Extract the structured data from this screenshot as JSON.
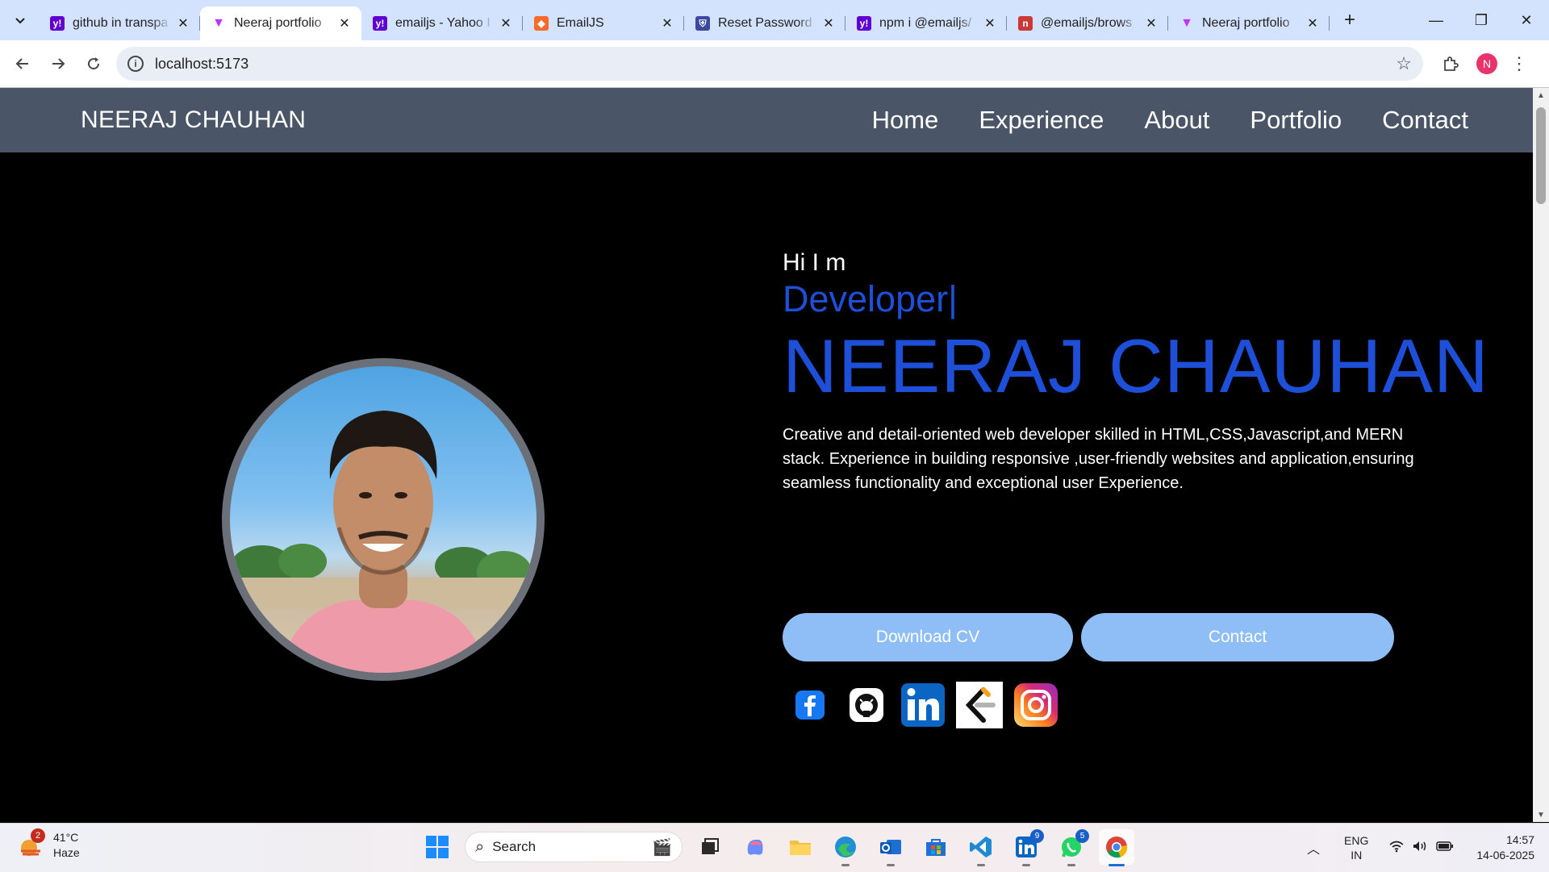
{
  "browser": {
    "tabs": [
      {
        "title": "github in transpa",
        "favicon": "yahoo-icon",
        "color": "#6001d2"
      },
      {
        "title": "Neeraj portfolio",
        "favicon": "vite-icon",
        "color": "#bd34fe",
        "active": true
      },
      {
        "title": "emailjs - Yahoo I",
        "favicon": "yahoo-icon",
        "color": "#6001d2"
      },
      {
        "title": "EmailJS",
        "favicon": "emailjs-icon",
        "color": "#f76a2a"
      },
      {
        "title": "Reset Password -",
        "favicon": "shield-icon",
        "color": "#3b4a9c"
      },
      {
        "title": "npm i @emailjs/",
        "favicon": "yahoo-icon",
        "color": "#6001d2"
      },
      {
        "title": "@emailjs/brows",
        "favicon": "npm-icon",
        "color": "#cb3837"
      },
      {
        "title": "Neeraj portfolio",
        "favicon": "vite-icon",
        "color": "#bd34fe"
      }
    ],
    "url": "localhost:5173",
    "profile_initial": "N"
  },
  "site": {
    "brand": "NEERAJ CHAUHAN",
    "nav": [
      "Home",
      "Experience",
      "About",
      "Portfolio",
      "Contact"
    ],
    "hero": {
      "greeting": "Hi I m",
      "role": "Developer|",
      "name": "NEERAJ CHAUHAN",
      "description": "Creative and detail-oriented web developer skilled in HTML,CSS,Javascript,and MERN stack. Experience in building responsive ,user-friendly websites and application,ensuring seamless functionality and exceptional user Experience.",
      "download_cv": "Download CV",
      "contact": "Contact"
    },
    "socials": [
      "facebook-icon",
      "github-icon",
      "linkedin-icon",
      "leetcode-icon",
      "instagram-icon"
    ],
    "accent": "#1d4fd8",
    "nav_bg": "#4a5668",
    "button_bg": "#8fbef7"
  },
  "taskbar": {
    "weather_badge": "2",
    "temperature": "41°C",
    "condition": "Haze",
    "search_placeholder": "Search",
    "linkedin_badge": "9",
    "whatsapp_badge": "5",
    "lang_top": "ENG",
    "lang_bottom": "IN",
    "time": "14:57",
    "date": "14-06-2025"
  }
}
